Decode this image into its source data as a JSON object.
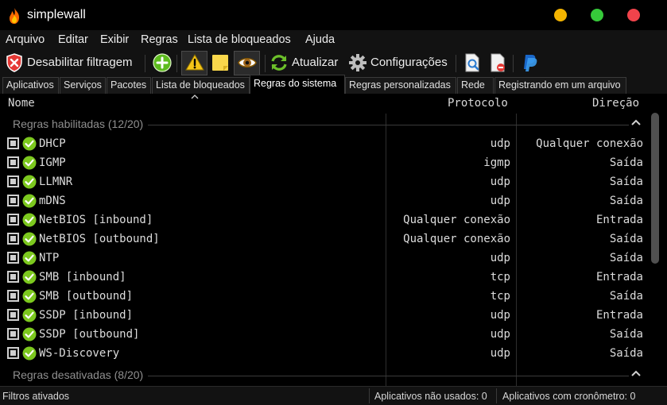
{
  "window": {
    "title": "simplewall"
  },
  "menu": [
    "Arquivo",
    "Editar",
    "Exibir",
    "Regras",
    "Lista de bloqueados",
    "Ajuda"
  ],
  "toolbar": {
    "disable_filter_label": "Desabilitar filtragem",
    "refresh_label": "Atualizar",
    "settings_label": "Configurações"
  },
  "tabs": [
    "Aplicativos",
    "Serviços",
    "Pacotes",
    "Lista de bloqueados",
    "Regras do sistema",
    "Regras personalizadas",
    "Rede",
    "Registrando em um arquivo"
  ],
  "active_tab": "Regras do sistema",
  "columns": {
    "name": "Nome",
    "protocol": "Protocolo",
    "direction": "Direção"
  },
  "groups": {
    "enabled": "Regras habilitadas (12/20)",
    "disabled": "Regras desativadas (8/20)"
  },
  "rules": [
    {
      "name": "DHCP",
      "protocol": "udp",
      "direction": "Qualquer conexão"
    },
    {
      "name": "IGMP",
      "protocol": "igmp",
      "direction": "Saída"
    },
    {
      "name": "LLMNR",
      "protocol": "udp",
      "direction": "Saída"
    },
    {
      "name": "mDNS",
      "protocol": "udp",
      "direction": "Saída"
    },
    {
      "name": "NetBIOS [inbound]",
      "protocol": "Qualquer conexão",
      "direction": "Entrada"
    },
    {
      "name": "NetBIOS [outbound]",
      "protocol": "Qualquer conexão",
      "direction": "Saída"
    },
    {
      "name": "NTP",
      "protocol": "udp",
      "direction": "Saída"
    },
    {
      "name": "SMB [inbound]",
      "protocol": "tcp",
      "direction": "Entrada"
    },
    {
      "name": "SMB [outbound]",
      "protocol": "tcp",
      "direction": "Saída"
    },
    {
      "name": "SSDP [inbound]",
      "protocol": "udp",
      "direction": "Entrada"
    },
    {
      "name": "SSDP [outbound]",
      "protocol": "udp",
      "direction": "Saída"
    },
    {
      "name": "WS-Discovery",
      "protocol": "udp",
      "direction": "Saída"
    }
  ],
  "status": {
    "filters": "Filtros ativados",
    "unused_apps": "Aplicativos não usados: 0",
    "timer_apps": "Aplicativos com cronômetro: 0"
  },
  "colors": {
    "accent_check": "#7cc81e",
    "win_min": "#f4b400",
    "win_max": "#36c93a",
    "win_close": "#f0434b"
  }
}
